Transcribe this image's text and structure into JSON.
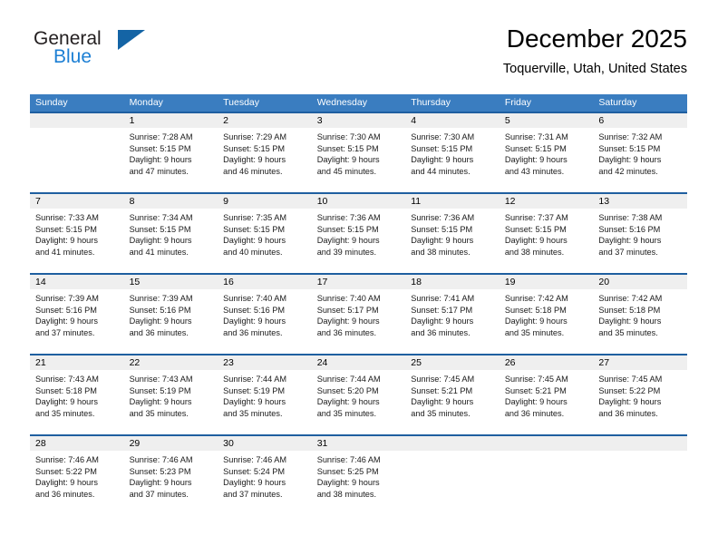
{
  "brand": {
    "word1": "General",
    "word2": "Blue",
    "logo_icon": "triangle-logo-icon",
    "color_primary": "#1464a5",
    "color_secondary": "#1c7fd4"
  },
  "header": {
    "month_title": "December 2025",
    "location": "Toquerville, Utah, United States"
  },
  "theme": {
    "header_row_bg": "#3a7dc0",
    "row_divider": "#1f5fa0",
    "daynum_band_bg": "#efefef"
  },
  "calendar": {
    "weekday_headers": [
      "Sunday",
      "Monday",
      "Tuesday",
      "Wednesday",
      "Thursday",
      "Friday",
      "Saturday"
    ],
    "weeks": [
      [
        {
          "day": "",
          "blank": true,
          "lines": []
        },
        {
          "day": "1",
          "lines": [
            "Sunrise: 7:28 AM",
            "Sunset: 5:15 PM",
            "Daylight: 9 hours",
            "and 47 minutes."
          ]
        },
        {
          "day": "2",
          "lines": [
            "Sunrise: 7:29 AM",
            "Sunset: 5:15 PM",
            "Daylight: 9 hours",
            "and 46 minutes."
          ]
        },
        {
          "day": "3",
          "lines": [
            "Sunrise: 7:30 AM",
            "Sunset: 5:15 PM",
            "Daylight: 9 hours",
            "and 45 minutes."
          ]
        },
        {
          "day": "4",
          "lines": [
            "Sunrise: 7:30 AM",
            "Sunset: 5:15 PM",
            "Daylight: 9 hours",
            "and 44 minutes."
          ]
        },
        {
          "day": "5",
          "lines": [
            "Sunrise: 7:31 AM",
            "Sunset: 5:15 PM",
            "Daylight: 9 hours",
            "and 43 minutes."
          ]
        },
        {
          "day": "6",
          "lines": [
            "Sunrise: 7:32 AM",
            "Sunset: 5:15 PM",
            "Daylight: 9 hours",
            "and 42 minutes."
          ]
        }
      ],
      [
        {
          "day": "7",
          "lines": [
            "Sunrise: 7:33 AM",
            "Sunset: 5:15 PM",
            "Daylight: 9 hours",
            "and 41 minutes."
          ]
        },
        {
          "day": "8",
          "lines": [
            "Sunrise: 7:34 AM",
            "Sunset: 5:15 PM",
            "Daylight: 9 hours",
            "and 41 minutes."
          ]
        },
        {
          "day": "9",
          "lines": [
            "Sunrise: 7:35 AM",
            "Sunset: 5:15 PM",
            "Daylight: 9 hours",
            "and 40 minutes."
          ]
        },
        {
          "day": "10",
          "lines": [
            "Sunrise: 7:36 AM",
            "Sunset: 5:15 PM",
            "Daylight: 9 hours",
            "and 39 minutes."
          ]
        },
        {
          "day": "11",
          "lines": [
            "Sunrise: 7:36 AM",
            "Sunset: 5:15 PM",
            "Daylight: 9 hours",
            "and 38 minutes."
          ]
        },
        {
          "day": "12",
          "lines": [
            "Sunrise: 7:37 AM",
            "Sunset: 5:15 PM",
            "Daylight: 9 hours",
            "and 38 minutes."
          ]
        },
        {
          "day": "13",
          "lines": [
            "Sunrise: 7:38 AM",
            "Sunset: 5:16 PM",
            "Daylight: 9 hours",
            "and 37 minutes."
          ]
        }
      ],
      [
        {
          "day": "14",
          "lines": [
            "Sunrise: 7:39 AM",
            "Sunset: 5:16 PM",
            "Daylight: 9 hours",
            "and 37 minutes."
          ]
        },
        {
          "day": "15",
          "lines": [
            "Sunrise: 7:39 AM",
            "Sunset: 5:16 PM",
            "Daylight: 9 hours",
            "and 36 minutes."
          ]
        },
        {
          "day": "16",
          "lines": [
            "Sunrise: 7:40 AM",
            "Sunset: 5:16 PM",
            "Daylight: 9 hours",
            "and 36 minutes."
          ]
        },
        {
          "day": "17",
          "lines": [
            "Sunrise: 7:40 AM",
            "Sunset: 5:17 PM",
            "Daylight: 9 hours",
            "and 36 minutes."
          ]
        },
        {
          "day": "18",
          "lines": [
            "Sunrise: 7:41 AM",
            "Sunset: 5:17 PM",
            "Daylight: 9 hours",
            "and 36 minutes."
          ]
        },
        {
          "day": "19",
          "lines": [
            "Sunrise: 7:42 AM",
            "Sunset: 5:18 PM",
            "Daylight: 9 hours",
            "and 35 minutes."
          ]
        },
        {
          "day": "20",
          "lines": [
            "Sunrise: 7:42 AM",
            "Sunset: 5:18 PM",
            "Daylight: 9 hours",
            "and 35 minutes."
          ]
        }
      ],
      [
        {
          "day": "21",
          "lines": [
            "Sunrise: 7:43 AM",
            "Sunset: 5:18 PM",
            "Daylight: 9 hours",
            "and 35 minutes."
          ]
        },
        {
          "day": "22",
          "lines": [
            "Sunrise: 7:43 AM",
            "Sunset: 5:19 PM",
            "Daylight: 9 hours",
            "and 35 minutes."
          ]
        },
        {
          "day": "23",
          "lines": [
            "Sunrise: 7:44 AM",
            "Sunset: 5:19 PM",
            "Daylight: 9 hours",
            "and 35 minutes."
          ]
        },
        {
          "day": "24",
          "lines": [
            "Sunrise: 7:44 AM",
            "Sunset: 5:20 PM",
            "Daylight: 9 hours",
            "and 35 minutes."
          ]
        },
        {
          "day": "25",
          "lines": [
            "Sunrise: 7:45 AM",
            "Sunset: 5:21 PM",
            "Daylight: 9 hours",
            "and 35 minutes."
          ]
        },
        {
          "day": "26",
          "lines": [
            "Sunrise: 7:45 AM",
            "Sunset: 5:21 PM",
            "Daylight: 9 hours",
            "and 36 minutes."
          ]
        },
        {
          "day": "27",
          "lines": [
            "Sunrise: 7:45 AM",
            "Sunset: 5:22 PM",
            "Daylight: 9 hours",
            "and 36 minutes."
          ]
        }
      ],
      [
        {
          "day": "28",
          "lines": [
            "Sunrise: 7:46 AM",
            "Sunset: 5:22 PM",
            "Daylight: 9 hours",
            "and 36 minutes."
          ]
        },
        {
          "day": "29",
          "lines": [
            "Sunrise: 7:46 AM",
            "Sunset: 5:23 PM",
            "Daylight: 9 hours",
            "and 37 minutes."
          ]
        },
        {
          "day": "30",
          "lines": [
            "Sunrise: 7:46 AM",
            "Sunset: 5:24 PM",
            "Daylight: 9 hours",
            "and 37 minutes."
          ]
        },
        {
          "day": "31",
          "lines": [
            "Sunrise: 7:46 AM",
            "Sunset: 5:25 PM",
            "Daylight: 9 hours",
            "and 38 minutes."
          ]
        },
        {
          "day": "",
          "blank": true,
          "lines": []
        },
        {
          "day": "",
          "blank": true,
          "lines": []
        },
        {
          "day": "",
          "blank": true,
          "lines": []
        }
      ]
    ]
  }
}
